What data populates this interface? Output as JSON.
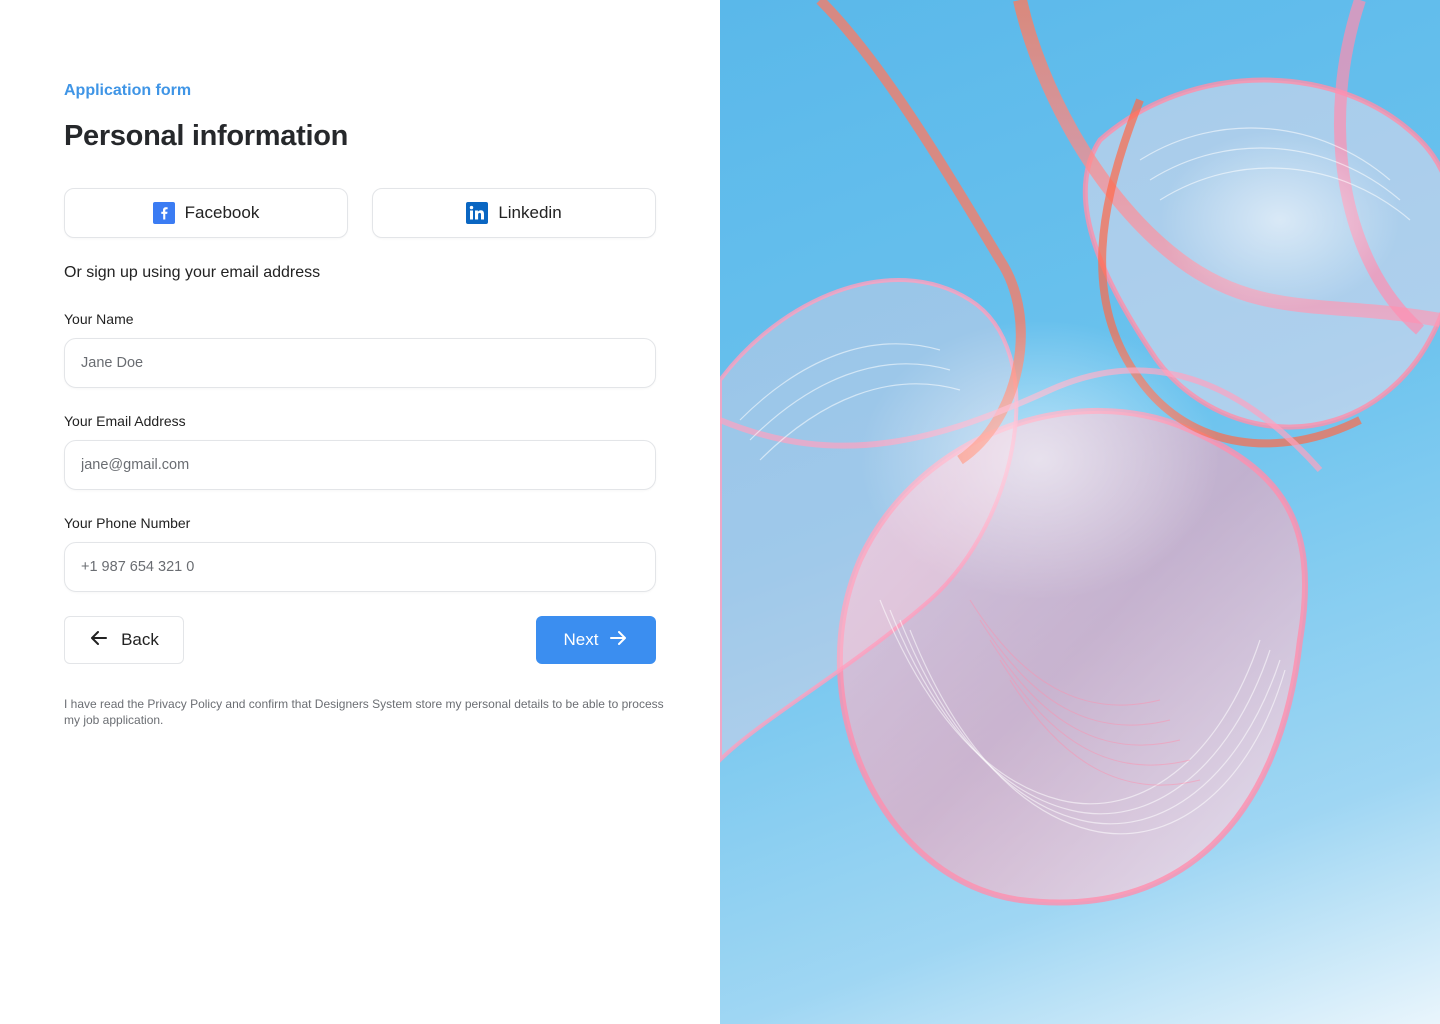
{
  "colors": {
    "accent": "#3b8ef0",
    "eyebrow": "#3f95e6",
    "facebook": "#3b7cf3",
    "linkedin": "#0a66c2"
  },
  "form": {
    "eyebrow": "Application form",
    "title": "Personal information",
    "social": {
      "facebook": {
        "label": "Facebook",
        "icon": "facebook-icon"
      },
      "linkedin": {
        "label": "Linkedin",
        "icon": "linkedin-icon"
      }
    },
    "divider_text": "Or sign up using your email address",
    "fields": {
      "name": {
        "label": "Your Name",
        "placeholder": "Jane Doe"
      },
      "email": {
        "label": "Your Email Address",
        "placeholder": "jane@gmail.com"
      },
      "phone": {
        "label": "Your Phone Number",
        "placeholder": "+1 987 654 321 0"
      }
    },
    "back_label": "Back",
    "next_label": "Next",
    "legal": "I have read the Privacy Policy and confirm that Designers System store my personal details to be able to process my job application."
  },
  "illustration": {
    "icon": "abstract-glass-ribbons-image"
  }
}
